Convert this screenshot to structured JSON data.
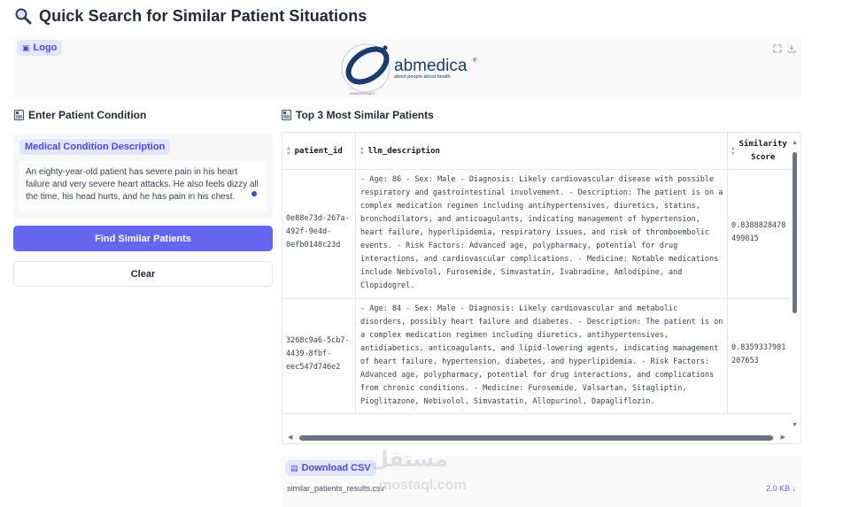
{
  "page": {
    "title": "Quick Search for Similar Patient Situations"
  },
  "logo_panel": {
    "chip_label": "Logo",
    "brand_name": "abmedica",
    "brand_mark": "®",
    "tagline": "about people about health",
    "ring_text": "ANNIVERSARY"
  },
  "input_section": {
    "heading": "Enter Patient Condition",
    "field_label": "Medical Condition Description",
    "field_value": "An eighty-year-old patient has severe pain in his heart failure and very severe heart attacks. He also feels dizzy all the time, his head hurts, and he has pain in his chest."
  },
  "buttons": {
    "find_label": "Find Similar Patients",
    "clear_label": "Clear"
  },
  "results": {
    "heading": "Top 3 Most Similar Patients",
    "columns": [
      "patient_id",
      "llm_description",
      "Similarity",
      "Score"
    ],
    "rows": [
      {
        "patient_id": [
          "0e88e73d-267a-",
          "492f-9e4d-",
          "0efb0148c23d"
        ],
        "description": [
          "- Age: 86 - Sex: Male - Diagnosis: Likely cardiovascular disease with possible",
          "respiratory and gastrointestinal involvement. - Description: The patient is on a",
          "complex medication regimen including antihypertensives, diuretics, statins,",
          "bronchodilators, and anticoagulants, indicating management of hypertension,",
          "heart failure, hyperlipidemia, respiratory issues, and risk of thromboembolic",
          "events. - Risk Factors: Advanced age, polypharmacy, potential for drug",
          "interactions, and cardiovascular complications. - Medicine: Notable medications",
          "include Nebivolol, Furosemide, Simvastatin, Ivabradine, Amlodipine, and",
          "Clopidogrel."
        ],
        "score": [
          "0.8388828478",
          "499815"
        ]
      },
      {
        "patient_id": [
          "3268c9a6-5cb7-",
          "4439-8fbf-",
          "eec547d746e2"
        ],
        "description": [
          "- Age: 84 - Sex: Male - Diagnosis: Likely cardiovascular and metabolic",
          "disorders, possibly heart failure and diabetes. - Description: The patient is on",
          "a complex medication regimen including diuretics, antihypertensives,",
          "antidiabetics, anticoagulants, and lipid-lowering agents, indicating management",
          "of heart failure, hypertension, diabetes, and hyperlipidemia. - Risk Factors:",
          "Advanced age, polypharmacy, potential for drug interactions, and complications",
          "from chronic conditions. - Medicine: Furosemide, Valsartan, Sitagliptin,",
          "Pioglitazone, Nebivolol, Simvastatin, Allopurinol, Dapagliflozin."
        ],
        "score": [
          "0.8359337981",
          "207653"
        ]
      }
    ]
  },
  "download": {
    "label": "Download CSV",
    "file_name": "similar_patients_results.csv",
    "file_size": "2.0 KB",
    "size_arrow": "↓"
  },
  "watermark": {
    "text": "مستقل",
    "sub": "mostaql.com"
  },
  "colors": {
    "accent": "#6366f1",
    "chip_bg": "#e0e7ff",
    "chip_text": "#4f46e5",
    "brand_blue": "#1c3a6e"
  }
}
